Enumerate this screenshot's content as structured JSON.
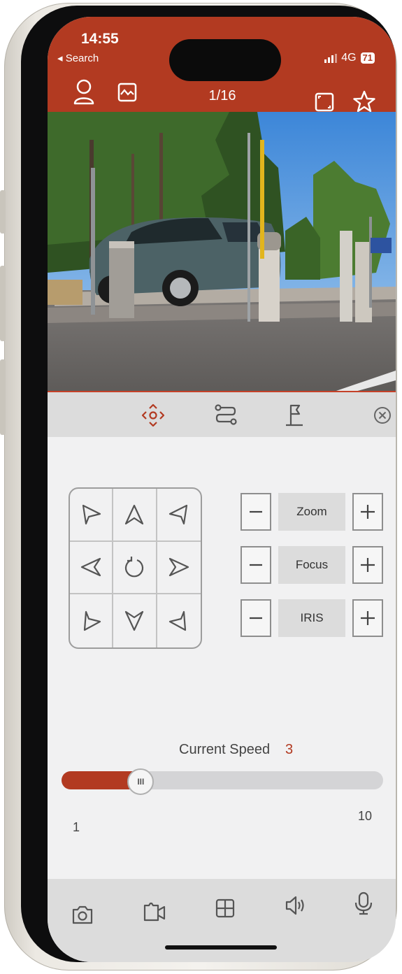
{
  "status_bar": {
    "time": "14:55",
    "back_label": "◂ Search",
    "network": "4G",
    "battery": "71"
  },
  "header": {
    "page_counter": "1/16",
    "icons": [
      "user-icon",
      "image-icon",
      "fullscreen-icon",
      "star-icon"
    ]
  },
  "control_tabs": {
    "icons": [
      "ptz-move-icon",
      "path-icon",
      "preset-flag-icon",
      "close-circle-icon"
    ],
    "active": "ptz-move-icon"
  },
  "dpad": {
    "icons": [
      "arrow-up-left-icon",
      "arrow-up-icon",
      "arrow-up-right-icon",
      "arrow-left-icon",
      "reset-rotate-icon",
      "arrow-right-icon",
      "arrow-down-left-icon",
      "arrow-down-icon",
      "arrow-down-right-icon"
    ]
  },
  "lens": {
    "zoom_label": "Zoom",
    "focus_label": "Focus",
    "iris_label": "IRIS",
    "minus_symbol": "−",
    "plus_symbol": "+"
  },
  "speed": {
    "label": "Current Speed",
    "value": 3,
    "min": 1,
    "max": 10,
    "thumb_glyph": "III"
  },
  "bottom_toolbar": {
    "icons": [
      "camera-snapshot-icon",
      "video-record-icon",
      "grid-layout-icon",
      "speaker-icon",
      "microphone-icon"
    ]
  },
  "colors": {
    "accent": "#b23a21",
    "panel_gray": "#dcdcdc",
    "background": "#f1f1f2"
  }
}
